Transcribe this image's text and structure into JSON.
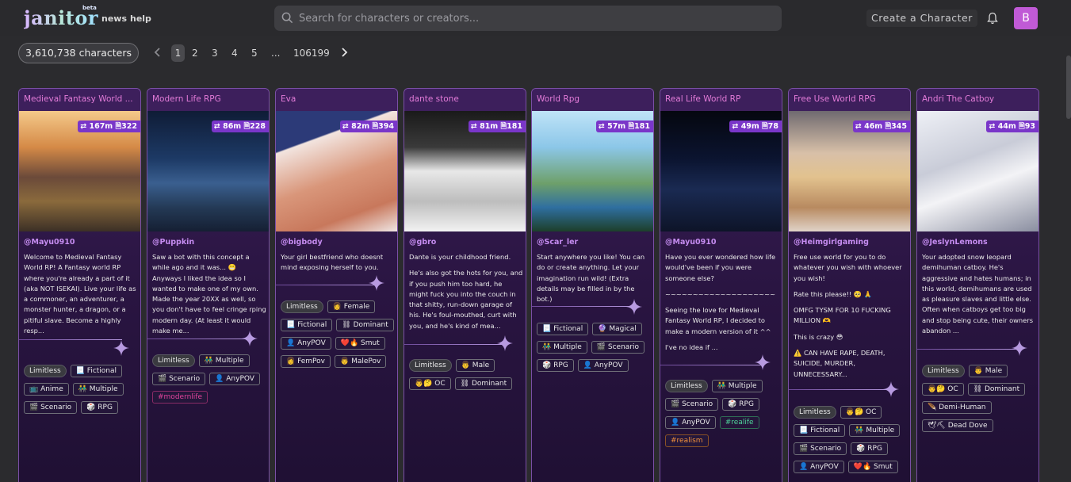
{
  "header": {
    "logo": "janitor",
    "beta": "beta",
    "nav": [
      {
        "label": "news"
      },
      {
        "label": "help"
      }
    ],
    "search_placeholder": "Search for characters or creators...",
    "create_label": "Create a Character",
    "avatar_letter": "B"
  },
  "pagination": {
    "count_label": "3,610,738 characters",
    "pages": [
      "1",
      "2",
      "3",
      "4",
      "5",
      "...",
      "106199"
    ],
    "current_page": "1"
  },
  "colors": {
    "accent": "#7a36c9",
    "title": "#e27bd8",
    "creator": "#c58cf0"
  },
  "cards": [
    {
      "title": "Medieval Fantasy World ...",
      "stats": {
        "chats": "167m",
        "messages": "322"
      },
      "creator": "@Mayu0910",
      "description": [
        "Welcome to Medieval Fantasy World RP! A Fantasy world RP where you're already a part of it (aka NOT ISEKAI). Live your life as a commoner, an adventurer, a monster hunter, a dragon, or a pitiful slave. Become a highly resp..."
      ],
      "tags": [
        {
          "label": "Limitless",
          "style": "pill"
        },
        {
          "label": "📃 Fictional",
          "style": ""
        },
        {
          "label": "📺 Anime",
          "style": ""
        },
        {
          "label": "👬 Multiple",
          "style": ""
        },
        {
          "label": "🎬 Scenario",
          "style": ""
        },
        {
          "label": "🎲 RPG",
          "style": ""
        }
      ]
    },
    {
      "title": "Modern Life RPG",
      "stats": {
        "chats": "86m",
        "messages": "228"
      },
      "creator": "@Puppkin",
      "description": [
        "Saw a bot with this concept a while ago and it was... 😬 Anyways I liked the idea so I wanted to make one of my own. Made the year 20XX as well, so you don't have to feel cringe rping modern day. (At least it would make me..."
      ],
      "tags": [
        {
          "label": "Limitless",
          "style": "pill"
        },
        {
          "label": "👬 Multiple",
          "style": ""
        },
        {
          "label": "🎬 Scenario",
          "style": ""
        },
        {
          "label": "👤 AnyPOV",
          "style": ""
        },
        {
          "label": "#modernlife",
          "style": "pink"
        }
      ]
    },
    {
      "title": "Eva",
      "stats": {
        "chats": "82m",
        "messages": "394"
      },
      "creator": "@bigbody",
      "description": [
        "Your girl bestfriend who doesnt mind exposing herself to you."
      ],
      "tags": [
        {
          "label": "Limitless",
          "style": "pill"
        },
        {
          "label": "👩 Female",
          "style": ""
        },
        {
          "label": "📃 Fictional",
          "style": ""
        },
        {
          "label": "⛓ Dominant",
          "style": ""
        },
        {
          "label": "👤 AnyPOV",
          "style": ""
        },
        {
          "label": "❤️🔥 Smut",
          "style": ""
        },
        {
          "label": "👩 FemPov",
          "style": ""
        },
        {
          "label": "👨 MalePov",
          "style": ""
        }
      ]
    },
    {
      "title": "dante stone",
      "stats": {
        "chats": "81m",
        "messages": "181"
      },
      "creator": "@gbro",
      "description": [
        "Dante is your childhood friend.",
        "He's also got the hots for you, and if you push him too hard, he might fuck you into the couch in that shitty, run-down garage of his. He's foul-mouthed, curt with you, and he's kind of mea..."
      ],
      "tags": [
        {
          "label": "Limitless",
          "style": "pill"
        },
        {
          "label": "👨 Male",
          "style": ""
        },
        {
          "label": "👨🤔 OC",
          "style": ""
        },
        {
          "label": "⛓ Dominant",
          "style": ""
        }
      ]
    },
    {
      "title": "World Rpg",
      "stats": {
        "chats": "57m",
        "messages": "181"
      },
      "creator": "@Scar_ler",
      "description": [
        "Start anywhere you like! You can do or create anything. Let your imagination run wild! (Extra details may be filled in by the bot.)"
      ],
      "tags": [
        {
          "label": "📃 Fictional",
          "style": ""
        },
        {
          "label": "🔮 Magical",
          "style": ""
        },
        {
          "label": "👬 Multiple",
          "style": ""
        },
        {
          "label": "🎬 Scenario",
          "style": ""
        },
        {
          "label": "🎲 RPG",
          "style": ""
        },
        {
          "label": "👤 AnyPOV",
          "style": ""
        }
      ]
    },
    {
      "title": "Real Life World RP",
      "stats": {
        "chats": "49m",
        "messages": "78"
      },
      "creator": "@Mayu0910",
      "description": [
        "Have you ever wondered how life would've been if you were someone else?",
        "~~~~~~~~~~~~~~~~~~~~",
        "Seeing the love for Medieval Fantasy World RP, I decided to make a modern version of it ^^",
        "I've no idea if ..."
      ],
      "tags": [
        {
          "label": "Limitless",
          "style": "pill"
        },
        {
          "label": "👬 Multiple",
          "style": ""
        },
        {
          "label": "🎬 Scenario",
          "style": ""
        },
        {
          "label": "🎲 RPG",
          "style": ""
        },
        {
          "label": "👤 AnyPOV",
          "style": ""
        },
        {
          "label": "#realife",
          "style": "green"
        },
        {
          "label": "#realism",
          "style": "orange"
        }
      ]
    },
    {
      "title": "Free Use World RPG",
      "stats": {
        "chats": "46m",
        "messages": "345"
      },
      "creator": "@Heimgirlgaming",
      "description": [
        "Free use world for you to do whatever you wish with whoever you wish!",
        "Rate this please!! 🥺 🙏",
        "OMFG TYSM FOR 10 FUCKING MILLION 🫶",
        "This is crazy 😳",
        "⚠️ CAN HAVE RAPE, DEATH, SUICIDE, MURDER, UNNECESSARY..."
      ],
      "tags": [
        {
          "label": "Limitless",
          "style": "pill"
        },
        {
          "label": "👨🤔 OC",
          "style": ""
        },
        {
          "label": "📃 Fictional",
          "style": ""
        },
        {
          "label": "👬 Multiple",
          "style": ""
        },
        {
          "label": "🎬 Scenario",
          "style": ""
        },
        {
          "label": "🎲 RPG",
          "style": ""
        },
        {
          "label": "👤 AnyPOV",
          "style": ""
        },
        {
          "label": "❤️🔥 Smut",
          "style": ""
        }
      ]
    },
    {
      "title": "Andri The Catboy",
      "stats": {
        "chats": "44m",
        "messages": "93"
      },
      "creator": "@JeslynLemons",
      "description": [
        "Your adopted snow leopard demihuman catboy. He's aggressive and hates humans; in this world, demihumans are used as pleasure slaves and little else. Often when catboys get too big and stop being cute, their owners abandon ..."
      ],
      "tags": [
        {
          "label": "Limitless",
          "style": "pill"
        },
        {
          "label": "👨 Male",
          "style": ""
        },
        {
          "label": "👨🤔 OC",
          "style": ""
        },
        {
          "label": "⛓ Dominant",
          "style": ""
        },
        {
          "label": "🪶 Demi-Human",
          "style": ""
        },
        {
          "label": "🕊⛏ Dead Dove",
          "style": ""
        }
      ]
    }
  ]
}
